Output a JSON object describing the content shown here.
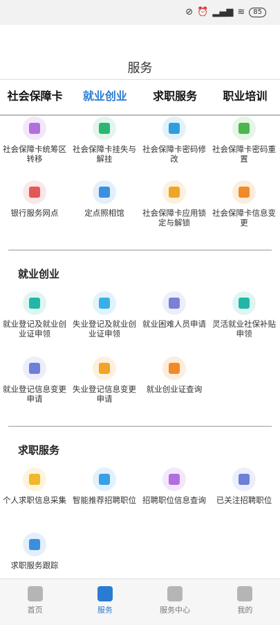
{
  "status": {
    "icons": [
      "mute-icon",
      "alarm-icon",
      "signal-icon",
      "wifi-icon"
    ],
    "battery": "85"
  },
  "header": {
    "title": "服务"
  },
  "tabs": [
    {
      "label": "社会保障卡",
      "active": false
    },
    {
      "label": "就业创业",
      "active": true
    },
    {
      "label": "求职服务",
      "active": false
    },
    {
      "label": "职业培训",
      "active": false
    }
  ],
  "social_card_items": [
    {
      "label": "社会保障卡统筹区转移",
      "icon": "card-transfer-icon",
      "color": "#b06ee0"
    },
    {
      "label": "社会保障卡挂失与解挂",
      "icon": "card-lock-icon",
      "color": "#2bb673"
    },
    {
      "label": "社会保障卡密码修改",
      "icon": "password-edit-icon",
      "color": "#2f9ee0"
    },
    {
      "label": "社会保障卡密码重置",
      "icon": "password-reset-icon",
      "color": "#4cb54c"
    },
    {
      "label": "银行服务网点",
      "icon": "bank-icon",
      "color": "#e45757"
    },
    {
      "label": "定点照相馆",
      "icon": "camera-shop-icon",
      "color": "#3b8fe0"
    },
    {
      "label": "社会保障卡应用锁定与解锁",
      "icon": "card-unlock-icon",
      "color": "#f0a42a"
    },
    {
      "label": "社会保障卡信息变更",
      "icon": "card-info-icon",
      "color": "#f08a2a"
    }
  ],
  "employment": {
    "title": "就业创业",
    "items": [
      {
        "label": "就业登记及就业创业证申领",
        "icon": "employment-register-icon",
        "color": "#22b6a6"
      },
      {
        "label": "失业登记及就业创业证申领",
        "icon": "unemployment-register-icon",
        "color": "#38b0e6"
      },
      {
        "label": "就业困难人员申请",
        "icon": "briefcase-icon",
        "color": "#7a7fd8"
      },
      {
        "label": "灵活就业社保补贴申领",
        "icon": "money-bag-icon",
        "color": "#22b6a6"
      },
      {
        "label": "就业登记信息变更申请",
        "icon": "doc-edit-icon",
        "color": "#6e7fd8"
      },
      {
        "label": "失业登记信息变更申请",
        "icon": "doc-change-icon",
        "color": "#f0a42a"
      },
      {
        "label": "就业创业证查询",
        "icon": "certificate-icon",
        "color": "#f08a2a"
      }
    ]
  },
  "job_service": {
    "title": "求职服务",
    "items": [
      {
        "label": "个人求职信息采集",
        "icon": "job-info-icon",
        "color": "#f0b82a"
      },
      {
        "label": "智能推荐招聘职位",
        "icon": "recommend-icon",
        "color": "#38a0e6"
      },
      {
        "label": "招聘职位信息查询",
        "icon": "job-search-icon",
        "color": "#b06ee0"
      },
      {
        "label": "已关注招聘职位",
        "icon": "followed-jobs-icon",
        "color": "#6e7fd8"
      },
      {
        "label": "求职服务跟踪",
        "icon": "tracking-icon",
        "color": "#3b8fe0"
      }
    ]
  },
  "bottom_nav": [
    {
      "label": "首页",
      "icon": "home-icon",
      "active": false
    },
    {
      "label": "服务",
      "icon": "services-icon",
      "active": true
    },
    {
      "label": "服务中心",
      "icon": "chat-icon",
      "active": false
    },
    {
      "label": "我的",
      "icon": "user-icon",
      "active": false
    }
  ]
}
